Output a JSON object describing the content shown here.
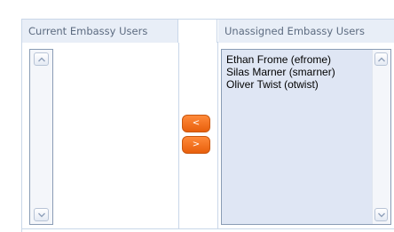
{
  "headers": {
    "current_users": "Current Embassy Users",
    "unassigned_users": "Unassigned Embassy Users"
  },
  "current_users_list": [],
  "unassigned_users_list": [
    "Ethan Frome (efrome)",
    "Silas Marner (smarner)",
    "Oliver Twist (otwist)"
  ],
  "buttons": {
    "move_left": "<",
    "move_right": ">"
  },
  "colors": {
    "accent_button": "#f07020",
    "header_bg": "#e8eef7",
    "listbox_selected_bg": "#dfe6f4",
    "border": "#c9d7e8"
  },
  "icons": {
    "scroll_up": "chevron-up-icon",
    "scroll_down": "chevron-down-icon"
  }
}
